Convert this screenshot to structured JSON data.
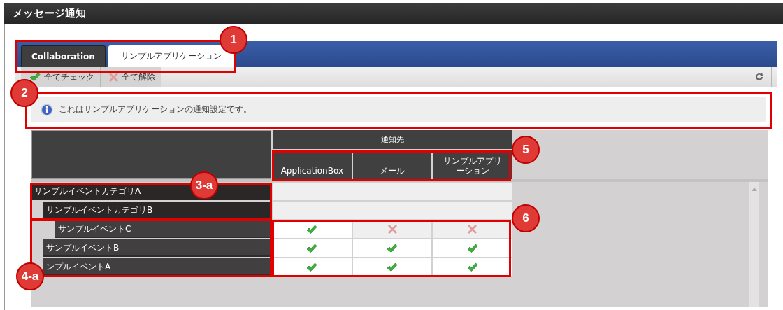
{
  "window": {
    "title": "メッセージ通知"
  },
  "tabs": [
    {
      "label": "Collaboration",
      "selected": false
    },
    {
      "label": "サンプルアプリケーション",
      "selected": true
    }
  ],
  "toolbar": {
    "buttons": [
      {
        "label": "全てチェック",
        "kind": "check"
      },
      {
        "label": "全て解除",
        "kind": "clear"
      }
    ]
  },
  "info": {
    "message": "これはサンプルアプリケーションの通知設定です。"
  },
  "matrix": {
    "group_header": "通知先",
    "columns": [
      {
        "lines": [
          "ApplicationBox"
        ]
      },
      {
        "lines": [
          "メール"
        ]
      },
      {
        "lines": [
          "サンプルアプリ",
          "ーション"
        ]
      }
    ],
    "rows": [
      {
        "label": "サンプルイベントカテゴリA",
        "kind": "category",
        "children": [
          {
            "label": "サンプルイベントカテゴリB",
            "kind": "category",
            "children": [
              {
                "label": "サンプルイベントC",
                "kind": "event",
                "cells": [
                  {
                    "checked": true
                  },
                  {
                    "checked": false
                  },
                  {
                    "checked": false
                  }
                ]
              }
            ]
          },
          {
            "label": "サンプルイベントB",
            "kind": "event",
            "cells": [
              {
                "checked": true
              },
              {
                "checked": true
              },
              {
                "checked": true
              }
            ]
          },
          {
            "label": "ンプルイベントA",
            "kind": "event",
            "cells": [
              {
                "checked": true
              },
              {
                "checked": true
              },
              {
                "checked": true
              }
            ]
          }
        ]
      }
    ]
  },
  "callouts": [
    {
      "label": "1"
    },
    {
      "label": "2"
    },
    {
      "label": "3-a"
    },
    {
      "label": "4-a"
    },
    {
      "label": "5"
    },
    {
      "label": "6"
    }
  ]
}
